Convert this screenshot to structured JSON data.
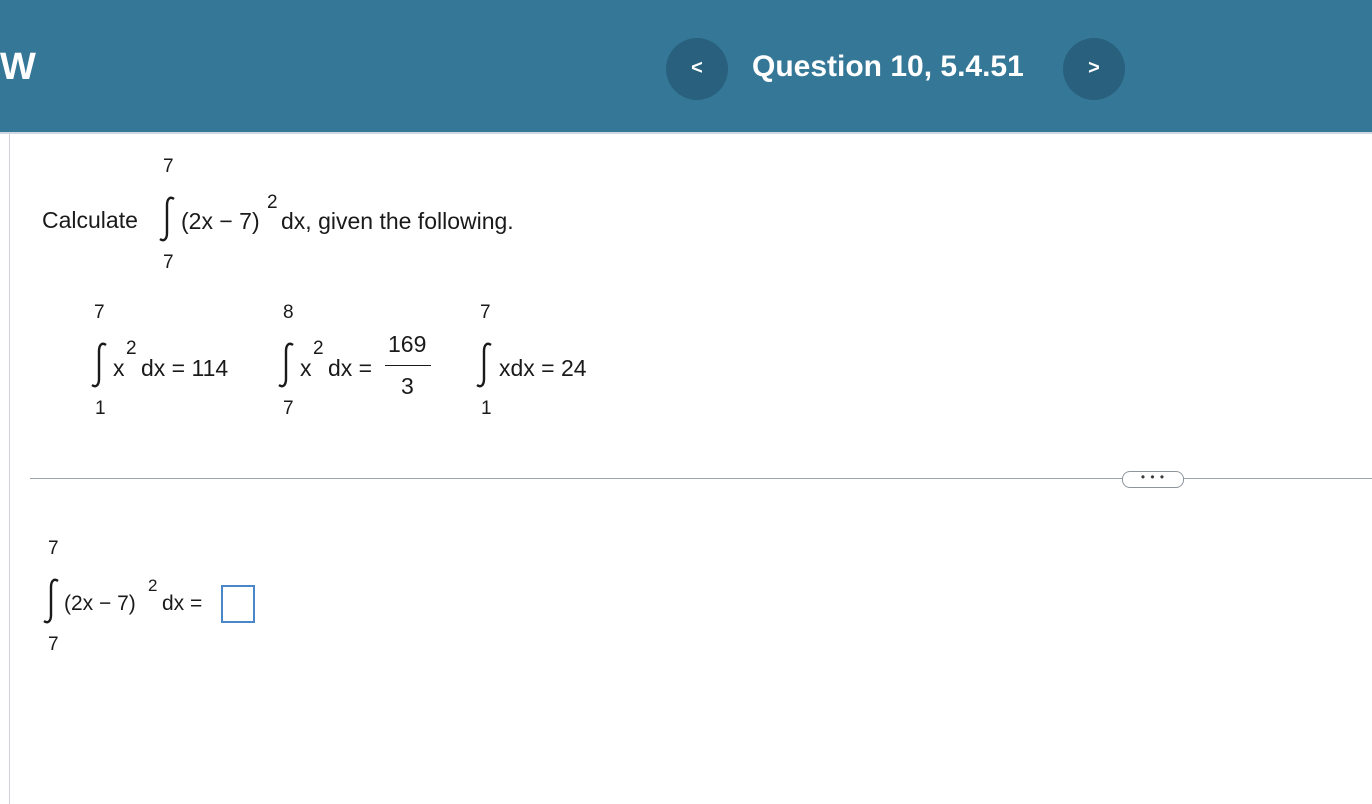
{
  "header": {
    "logo_text": "W",
    "question_title": "Question 10, 5.4.51",
    "prev_label": "<",
    "next_label": ">"
  },
  "problem": {
    "lead": "Calculate",
    "upper": "7",
    "lower": "7",
    "integrand_pre": "(2x − 7)",
    "exponent": "2",
    "integrand_post": "dx, given the following."
  },
  "given": [
    {
      "upper": "7",
      "lower": "1",
      "base": "x",
      "exponent": "2",
      "tail": "dx = 114"
    },
    {
      "upper": "8",
      "lower": "7",
      "base": "x",
      "exponent": "2",
      "tail": "dx =",
      "numerator": "169",
      "denominator": "3"
    },
    {
      "upper": "7",
      "lower": "1",
      "body": "xdx = 24"
    }
  ],
  "more_button_label": "• • •",
  "answer": {
    "upper": "7",
    "lower": "7",
    "integrand_pre": "(2x − 7)",
    "exponent": "2",
    "integrand_post": "dx =",
    "value": ""
  },
  "colors": {
    "header_bg": "#357797",
    "nav_button_bg": "#28607e",
    "answer_box_border": "#4a86c8"
  }
}
